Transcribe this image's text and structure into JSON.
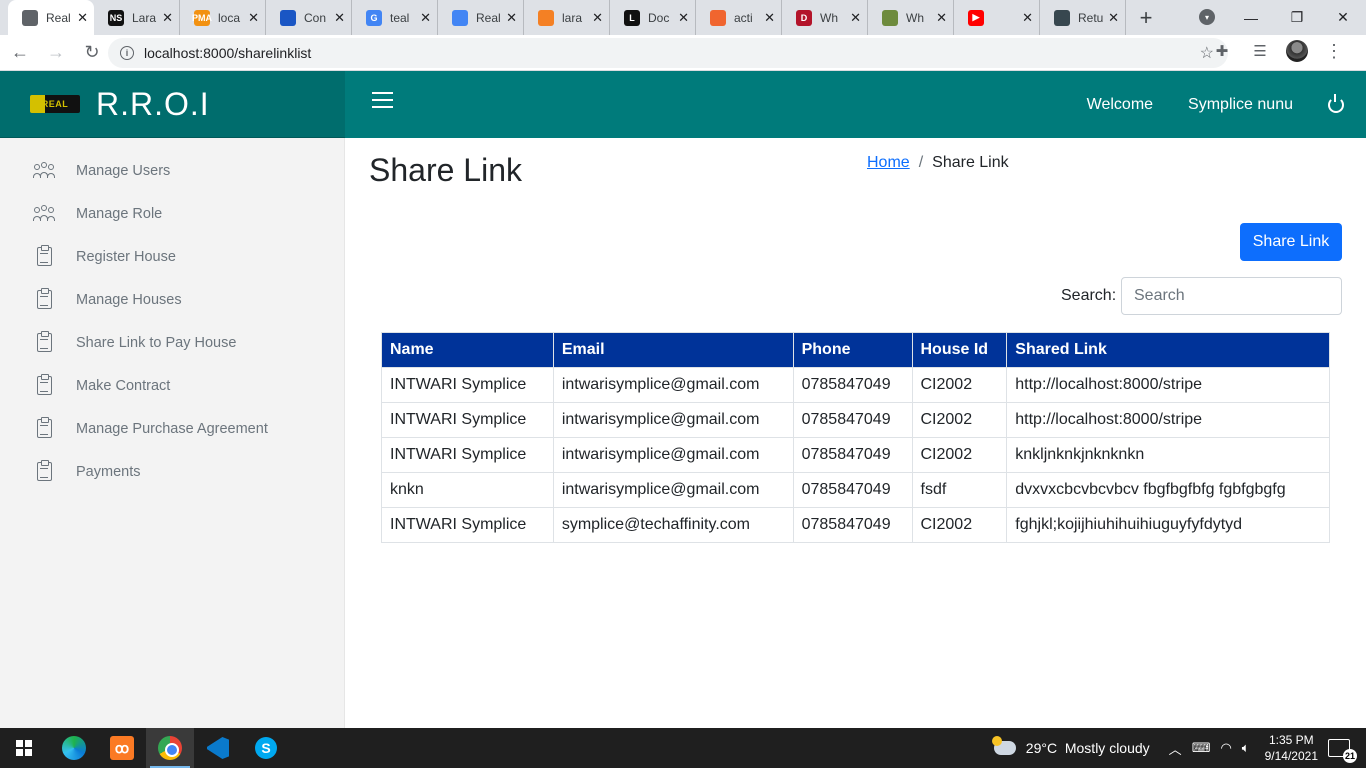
{
  "browser": {
    "tabs": [
      {
        "title": "Real",
        "favicon_color": "#5f6368",
        "favicon_glyph": ""
      },
      {
        "title": "Lara",
        "favicon_color": "#111111",
        "favicon_glyph": "NS"
      },
      {
        "title": "loca",
        "favicon_color": "#f29111",
        "favicon_glyph": "PMA"
      },
      {
        "title": "Con",
        "favicon_color": "#1a56c4",
        "favicon_glyph": ""
      },
      {
        "title": "teal",
        "favicon_color": "#4285f4",
        "favicon_glyph": "G"
      },
      {
        "title": "Real",
        "favicon_color": "#4285f4",
        "favicon_glyph": ""
      },
      {
        "title": "lara",
        "favicon_color": "#f48024",
        "favicon_glyph": ""
      },
      {
        "title": "Doc",
        "favicon_color": "#111111",
        "favicon_glyph": "L"
      },
      {
        "title": "acti",
        "favicon_color": "#f0652f",
        "favicon_glyph": ""
      },
      {
        "title": "Wh",
        "favicon_color": "#b3142a",
        "favicon_glyph": "D"
      },
      {
        "title": "Wh",
        "favicon_color": "#6e8b3d",
        "favicon_glyph": ""
      },
      {
        "title": "",
        "favicon_color": "#ff0000",
        "favicon_glyph": "▶"
      },
      {
        "title": "Retu",
        "favicon_color": "#37474f",
        "favicon_glyph": ""
      }
    ],
    "url": "localhost:8000/sharelinklist"
  },
  "header": {
    "logo_text": "REAL",
    "brand": "R.R.O.I",
    "welcome": "Welcome",
    "user_name": "Symplice nunu"
  },
  "sidebar": {
    "items": [
      {
        "label": "Manage Users",
        "icon": "users-icon"
      },
      {
        "label": "Manage Role",
        "icon": "users-icon"
      },
      {
        "label": "Register House",
        "icon": "clipboard-icon"
      },
      {
        "label": "Manage Houses",
        "icon": "clipboard-icon"
      },
      {
        "label": "Share Link to Pay House",
        "icon": "clipboard-icon"
      },
      {
        "label": "Make Contract",
        "icon": "clipboard-icon"
      },
      {
        "label": "Manage Purchase Agreement",
        "icon": "clipboard-icon"
      },
      {
        "label": "Payments",
        "icon": "clipboard-icon"
      }
    ]
  },
  "main": {
    "title": "Share Link",
    "breadcrumb": {
      "home": "Home",
      "separator": "/",
      "current": "Share Link"
    },
    "share_button": "Share Link",
    "search_label": "Search:",
    "search_placeholder": "Search",
    "table": {
      "columns": [
        "Name",
        "Email",
        "Phone",
        "House Id",
        "Shared Link"
      ],
      "rows": [
        [
          "INTWARI Symplice",
          "intwarisymplice@gmail.com",
          "0785847049",
          "CI2002",
          "http://localhost:8000/stripe"
        ],
        [
          "INTWARI Symplice",
          "intwarisymplice@gmail.com",
          "0785847049",
          "CI2002",
          "http://localhost:8000/stripe"
        ],
        [
          "INTWARI Symplice",
          "intwarisymplice@gmail.com",
          "0785847049",
          "CI2002",
          "knkljnknkjnknknkn"
        ],
        [
          "knkn",
          "intwarisymplice@gmail.com",
          "0785847049",
          "fsdf",
          "dvxvxcbcvbcvbcv fbgfbgfbfg fgbfgbgfg"
        ],
        [
          "INTWARI Symplice",
          "symplice@techaffinity.com",
          "0785847049",
          "CI2002",
          "fghjkl;kojijhiuhihuihiuguyfyfdytyd"
        ]
      ]
    }
  },
  "taskbar": {
    "xampp_glyph": "ꝏ",
    "skype_glyph": "S",
    "weather": "29°C  Mostly cloudy",
    "time": "1:35 PM",
    "date": "9/14/2021",
    "notification_count": "21"
  },
  "colors": {
    "header": "#007b7b",
    "brand_bg": "#006d6d",
    "table_header": "#003399",
    "primary_button": "#0d6efd"
  }
}
